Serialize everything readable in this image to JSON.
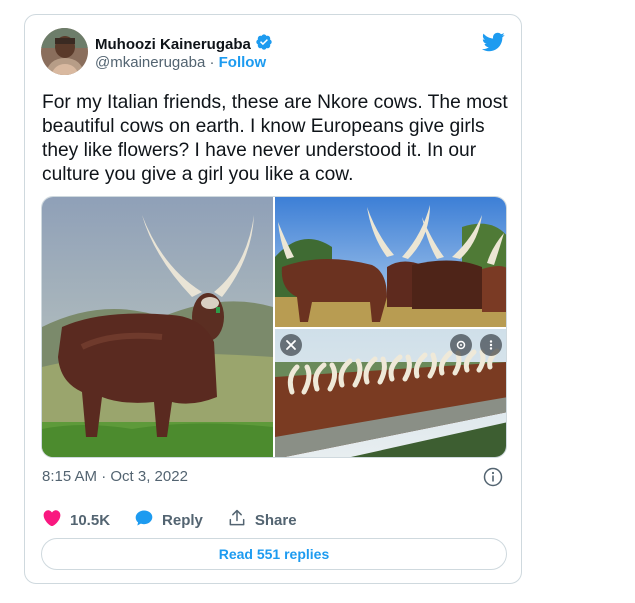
{
  "author": {
    "name": "Muhoozi Kainerugaba",
    "handle": "@mkainerugaba",
    "separator": " · ",
    "follow_label": "Follow",
    "verified": true
  },
  "tweet": {
    "text": "For my Italian friends, these are Nkore cows. The most beautiful cows on earth. I know Europeans give girls they like flowers? I have never understood it. In our culture you give a girl you like a cow.",
    "timestamp": "8:15 AM · Oct 3, 2022"
  },
  "actions": {
    "likes": "10.5K",
    "reply_label": "Reply",
    "share_label": "Share"
  },
  "read_replies_label": "Read 551 replies",
  "colors": {
    "accent": "#1d9bf0",
    "like": "#f91880",
    "text": "#0f1419",
    "muted": "#536471",
    "border": "#cfd9de"
  },
  "icons": {
    "brand": "twitter-bird-icon",
    "verified": "verified-badge-icon",
    "like": "heart-icon",
    "reply": "speech-bubble-icon",
    "share": "share-upload-icon",
    "info": "info-icon"
  }
}
